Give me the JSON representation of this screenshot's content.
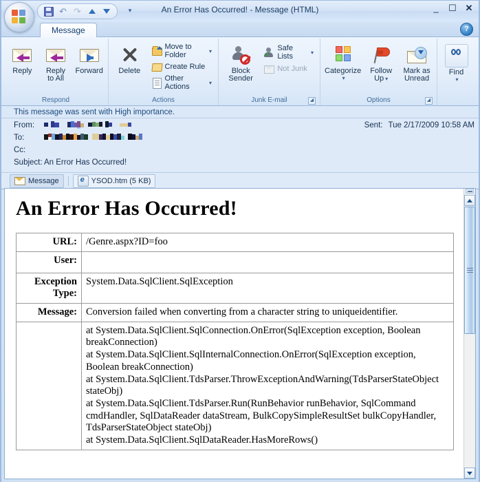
{
  "window": {
    "title": "An Error Has Occurred! - Message (HTML)",
    "minimize_label": "–",
    "maximize_label": "❐",
    "close_label": "✕",
    "help_label": "?"
  },
  "quick_access": {
    "items": [
      {
        "name": "save",
        "label": "Save"
      },
      {
        "name": "undo",
        "label": "Undo",
        "glyph": "↶"
      },
      {
        "name": "redo",
        "label": "Redo",
        "glyph": "↷"
      },
      {
        "name": "previous-item",
        "label": "Previous Item"
      },
      {
        "name": "next-item",
        "label": "Next Item"
      }
    ],
    "customize_glyph": "▾"
  },
  "tabs": [
    {
      "label": "Message",
      "active": true
    }
  ],
  "ribbon": {
    "groups": [
      {
        "label": "Respond",
        "buttons": [
          {
            "label": "Reply",
            "icon": "reply-icon"
          },
          {
            "label": "Reply\nto All",
            "line1": "Reply",
            "line2": "to All",
            "icon": "reply-all-icon"
          },
          {
            "label": "Forward",
            "icon": "forward-icon"
          }
        ]
      },
      {
        "label": "Actions",
        "big": [
          {
            "label": "Delete",
            "icon": "delete-icon"
          }
        ],
        "small": [
          {
            "label": "Move to Folder",
            "icon": "move-to-folder-icon",
            "has_caret": true
          },
          {
            "label": "Create Rule",
            "icon": "create-rule-icon",
            "has_caret": false
          },
          {
            "label": "Other Actions",
            "icon": "other-actions-icon",
            "has_caret": true
          }
        ]
      },
      {
        "label": "Junk E-mail",
        "big": [
          {
            "line1": "Block",
            "line2": "Sender",
            "icon": "block-sender-icon"
          }
        ],
        "small": [
          {
            "label": "Safe Lists",
            "icon": "safe-lists-icon",
            "has_caret": true,
            "disabled": false
          },
          {
            "label": "Not Junk",
            "icon": "not-junk-icon",
            "has_caret": false,
            "disabled": true
          }
        ],
        "has_dialog_launcher": true
      },
      {
        "label": "Options",
        "buttons": [
          {
            "label": "Categorize",
            "icon": "categorize-icon",
            "has_caret": true
          },
          {
            "line1": "Follow",
            "line2": "Up",
            "icon": "follow-up-icon",
            "has_caret": true
          },
          {
            "line1": "Mark as",
            "line2": "Unread",
            "icon": "mark-unread-icon",
            "has_caret": false
          }
        ],
        "has_dialog_launcher": true
      },
      {
        "label": "",
        "buttons": [
          {
            "label": "Find",
            "icon": "find-icon",
            "has_caret": true
          }
        ]
      }
    ],
    "dialog_launcher_glyph": "↘"
  },
  "info_bar": {
    "text": "This message was sent with High importance."
  },
  "header": {
    "from_label": "From:",
    "from_value": "",
    "to_label": "To:",
    "to_value": "",
    "cc_label": "Cc:",
    "cc_value": "",
    "subject_label": "Subject:",
    "subject_value": "An Error Has Occurred!",
    "sent_label": "Sent:",
    "sent_value": "Tue 2/17/2009 10:58 AM"
  },
  "attachments": {
    "message_chip_label": "Message",
    "items": [
      {
        "name": "YSOD.htm",
        "size": "(5 KB)",
        "label": "YSOD.htm (5 KB)"
      }
    ]
  },
  "body": {
    "heading": "An Error Has Occurred!",
    "rows": [
      {
        "key": "URL:",
        "value": "/Genre.aspx?ID=foo"
      },
      {
        "key": "User:",
        "value": ""
      },
      {
        "key": "Exception Type:",
        "value": "System.Data.SqlClient.SqlException"
      },
      {
        "key": "Message:",
        "value": "Conversion failed when converting from a character string to uniqueidentifier."
      },
      {
        "key": "",
        "value": "at System.Data.SqlClient.SqlConnection.OnError(SqlException exception, Boolean breakConnection)\nat System.Data.SqlClient.SqlInternalConnection.OnError(SqlException exception, Boolean breakConnection)\nat System.Data.SqlClient.TdsParser.ThrowExceptionAndWarning(TdsParserStateObject stateObj)\nat System.Data.SqlClient.TdsParser.Run(RunBehavior runBehavior, SqlCommand cmdHandler, SqlDataReader dataStream, BulkCopySimpleResultSet bulkCopyHandler, TdsParserStateObject stateObj)\nat System.Data.SqlClient.SqlDataReader.HasMoreRows()"
      }
    ]
  },
  "scrollbar": {
    "up_label": "▲",
    "down_label": "▼"
  },
  "colors": {
    "accent": "#2f6fbe",
    "titlebar": "#d4e3f6",
    "ribbon": "#e3edfa",
    "info_bar_text": "#1c4a7d",
    "body_background": "#ffffff"
  }
}
